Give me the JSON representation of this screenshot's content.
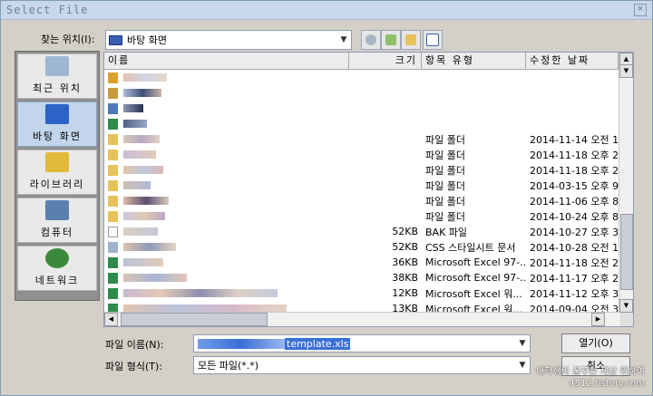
{
  "window": {
    "title": "Select File",
    "close_glyph": "×"
  },
  "lookin": {
    "label": "찾는 위치(I):",
    "value": "바탕 화면",
    "dropdown_glyph": "▼"
  },
  "places": [
    {
      "label": "최근 위치",
      "icon": "recent-places-icon",
      "color": "#9fb6d3"
    },
    {
      "label": "바탕 화면",
      "icon": "desktop-icon",
      "color": "#2b63c6"
    },
    {
      "label": "라이브러리",
      "icon": "library-icon",
      "color": "#e3b93c"
    },
    {
      "label": "컴퓨터",
      "icon": "computer-icon",
      "color": "#5b7faf"
    },
    {
      "label": "네트워크",
      "icon": "network-icon",
      "color": "#3b8a3b"
    }
  ],
  "columns": {
    "name": "이름",
    "size": "크기",
    "type": "항목 유형",
    "modified": "수정한 날짜"
  },
  "files": [
    {
      "icon": "library-icon",
      "color": "#d9a02e",
      "size": "",
      "type": "",
      "modified": ""
    },
    {
      "icon": "user-folder-icon",
      "color": "#c79a3b",
      "size": "",
      "type": "",
      "modified": ""
    },
    {
      "icon": "computer-icon",
      "color": "#4d79b8",
      "size": "",
      "type": "",
      "modified": ""
    },
    {
      "icon": "network-icon",
      "color": "#2f8a4b",
      "size": "",
      "type": "",
      "modified": ""
    },
    {
      "icon": "folder-icon",
      "color": "#e7c25a",
      "size": "",
      "type": "파일 폴더",
      "modified": "2014-11-14 오전 1"
    },
    {
      "icon": "folder-icon",
      "color": "#e7c25a",
      "size": "",
      "type": "파일 폴더",
      "modified": "2014-11-18 오후 2"
    },
    {
      "icon": "folder-icon",
      "color": "#e7c25a",
      "size": "",
      "type": "파일 폴더",
      "modified": "2014-11-18 오후 2"
    },
    {
      "icon": "folder-icon",
      "color": "#e7c25a",
      "size": "",
      "type": "파일 폴더",
      "modified": "2014-03-15 오후 9"
    },
    {
      "icon": "folder-icon",
      "color": "#e7c25a",
      "size": "",
      "type": "파일 폴더",
      "modified": "2014-11-06 오후 8"
    },
    {
      "icon": "folder-icon",
      "color": "#e7c25a",
      "size": "",
      "type": "파일 폴더",
      "modified": "2014-10-24 오후 8"
    },
    {
      "icon": "file-icon",
      "color": "#ffffff",
      "size": "52KB",
      "type": "BAK 파일",
      "modified": "2014-10-27 오후 3"
    },
    {
      "icon": "css-file-icon",
      "color": "#9fb2cc",
      "size": "52KB",
      "type": "CSS 스타일시트 문서",
      "modified": "2014-10-28 오전 1"
    },
    {
      "icon": "excel-icon",
      "color": "#2f8a4b",
      "size": "36KB",
      "type": "Microsoft Excel 97-...",
      "modified": "2014-11-18 오전 2"
    },
    {
      "icon": "excel-icon",
      "color": "#2f8a4b",
      "size": "38KB",
      "type": "Microsoft Excel 97-...",
      "modified": "2014-11-17 오후 2"
    },
    {
      "icon": "excel-icon",
      "color": "#2f8a4b",
      "size": "12KB",
      "type": "Microsoft Excel 워...",
      "modified": "2014-11-12 오후 3"
    },
    {
      "icon": "excel-icon",
      "color": "#2f8a4b",
      "size": "13KB",
      "type": "Microsoft Excel 워...",
      "modified": "2014-09-04 오전 3"
    }
  ],
  "filename": {
    "label": "파일 이름(N):",
    "value": "template.xls",
    "dropdown_glyph": "▼"
  },
  "filetype": {
    "label": "파일 형식(T):",
    "value": "모든 파일(*.*)",
    "dropdown_glyph": "▼"
  },
  "buttons": {
    "open": "열기(O)",
    "cancel": "취소"
  },
  "watermark": {
    "line1": "대학생이 꿈꾸는 세상 위하여",
    "line2": "4512.tistory.com"
  }
}
